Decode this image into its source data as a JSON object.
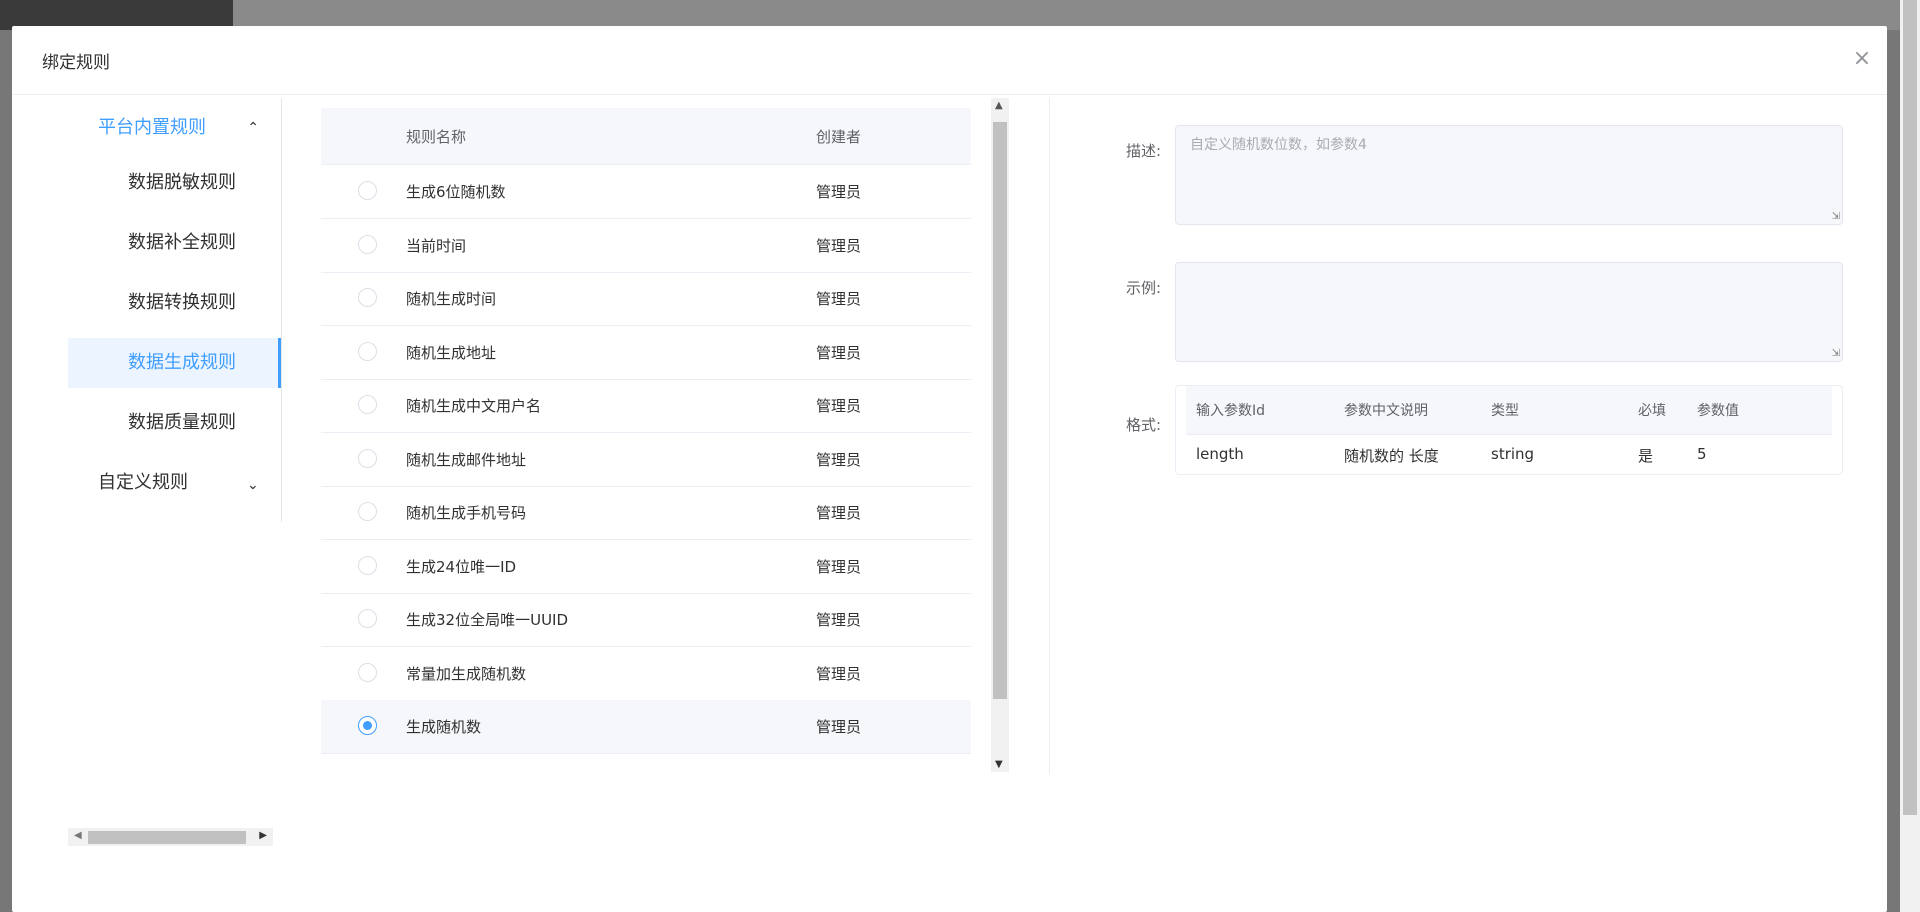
{
  "dialog": {
    "title": "绑定规则",
    "close_icon": "×"
  },
  "menu": {
    "group_builtin": "平台内置规则",
    "group_custom": "自定义规则",
    "items": [
      {
        "label": "数据脱敏规则"
      },
      {
        "label": "数据补全规则"
      },
      {
        "label": "数据转换规则"
      },
      {
        "label": "数据生成规则"
      },
      {
        "label": "数据质量规则"
      }
    ],
    "active": "数据生成规则"
  },
  "table": {
    "headers": {
      "name": "规则名称",
      "creator": "创建者"
    },
    "rows": [
      {
        "name": "生成6位随机数",
        "creator": "管理员",
        "selected": false
      },
      {
        "name": "当前时间",
        "creator": "管理员",
        "selected": false
      },
      {
        "name": "随机生成时间",
        "creator": "管理员",
        "selected": false
      },
      {
        "name": "随机生成地址",
        "creator": "管理员",
        "selected": false
      },
      {
        "name": "随机生成中文用户名",
        "creator": "管理员",
        "selected": false
      },
      {
        "name": "随机生成邮件地址",
        "creator": "管理员",
        "selected": false
      },
      {
        "name": "随机生成手机号码",
        "creator": "管理员",
        "selected": false
      },
      {
        "name": "生成24位唯一ID",
        "creator": "管理员",
        "selected": false
      },
      {
        "name": "生成32位全局唯一UUID",
        "creator": "管理员",
        "selected": false
      },
      {
        "name": "常量加生成随机数",
        "creator": "管理员",
        "selected": false
      },
      {
        "name": "生成随机数",
        "creator": "管理员",
        "selected": true
      }
    ]
  },
  "form": {
    "desc_label": "描述:",
    "desc_value": "自定义随机数位数，如参数4",
    "example_label": "示例:",
    "example_value": "",
    "format_label": "格式:",
    "format_headers": {
      "param_id": "输入参数Id",
      "param_cn": "参数中文说明",
      "type": "类型",
      "required": "必填",
      "value": "参数值"
    },
    "format_row": {
      "param_id": "length",
      "param_cn": "随机数的 长度",
      "type": "string",
      "required": "是",
      "value": "5"
    }
  },
  "colors": {
    "accent": "#409eff",
    "header_bg": "#f5f7fa"
  }
}
